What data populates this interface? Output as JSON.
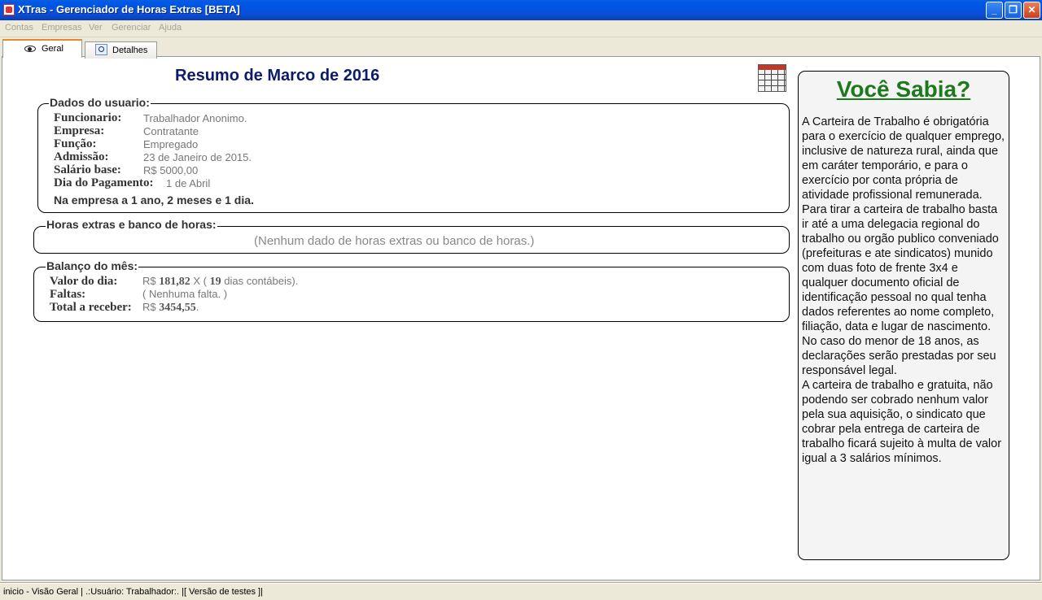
{
  "window": {
    "title": "XTras - Gerenciador de Horas Extras [BETA]"
  },
  "menu": [
    "Contas",
    "Empresas",
    "Ver",
    "Gerenciar",
    "Ajuda"
  ],
  "tabs": [
    {
      "label": "Geral",
      "icon": "eye-icon",
      "active": true
    },
    {
      "label": "Detalhes",
      "icon": "magnifier-document-icon",
      "active": false
    }
  ],
  "summary": {
    "title": "Resumo de Marco de 2016"
  },
  "user_data": {
    "legend": "Dados do usuario:",
    "rows": [
      {
        "label": "Funcionario:",
        "value": "Trabalhador  Anonimo."
      },
      {
        "label": "Empresa:",
        "value": "Contratante"
      },
      {
        "label": "Função:",
        "value": "Empregado"
      },
      {
        "label": "Admissão:",
        "value": "23 de Janeiro de 2015."
      },
      {
        "label": "Salário base:",
        "value": "R$ 5000,00"
      },
      {
        "label": "Dia do Pagamento:",
        "value": "1 de Abril"
      }
    ],
    "tenure": "Na empresa a 1 ano, 2 meses e 1 dia."
  },
  "overtime": {
    "legend": "Horas extras e banco de horas:",
    "empty_message": "(Nenhum dado de horas extras ou banco de horas.)"
  },
  "balance": {
    "legend": "Balanço do mês:",
    "day_value": {
      "label": "Valor do dia:",
      "prefix": "R$",
      "amount": "181,82",
      "mid": "X (",
      "days": "19",
      "suffix": "dias contábeis)."
    },
    "absences": {
      "label": "Faltas:",
      "value": "( Nenhuma falta.   )"
    },
    "total": {
      "label": "Total a receber:",
      "prefix": "R$",
      "amount": "3454,55",
      "suffix": "."
    }
  },
  "did_you_know": {
    "title": "Você Sabia?",
    "paragraphs": [
      "A Carteira de Trabalho é obrigatória para o exercício de qualquer emprego, inclusive de natureza rural, ainda que em caráter temporário, e para o exercício por conta própria de atividade profissional remunerada.",
      "Para tirar a carteira de trabalho basta ir até a uma delegacia regional do trabalho ou orgão publico conveniado (prefeituras e ate sindicatos) munido com duas foto de frente 3x4 e qualquer documento oficial de identificação pessoal no qual tenha dados referentes ao nome completo, filiação, data e lugar de nascimento.",
      "No caso do menor de 18 anos, as declarações serão prestadas por seu responsável legal.",
      "A carteira de trabalho e gratuita, não podendo ser cobrado nenhum valor pela sua aquisição, o sindicato que cobrar pela entrega de carteira  de trabalho ficará sujeito à multa de valor igual a 3 salários mínimos."
    ]
  },
  "status_bar": {
    "text": "inicio - Visão Geral | .:Usuário: Trabalhador:. |[    Versão de testes  ]|"
  }
}
